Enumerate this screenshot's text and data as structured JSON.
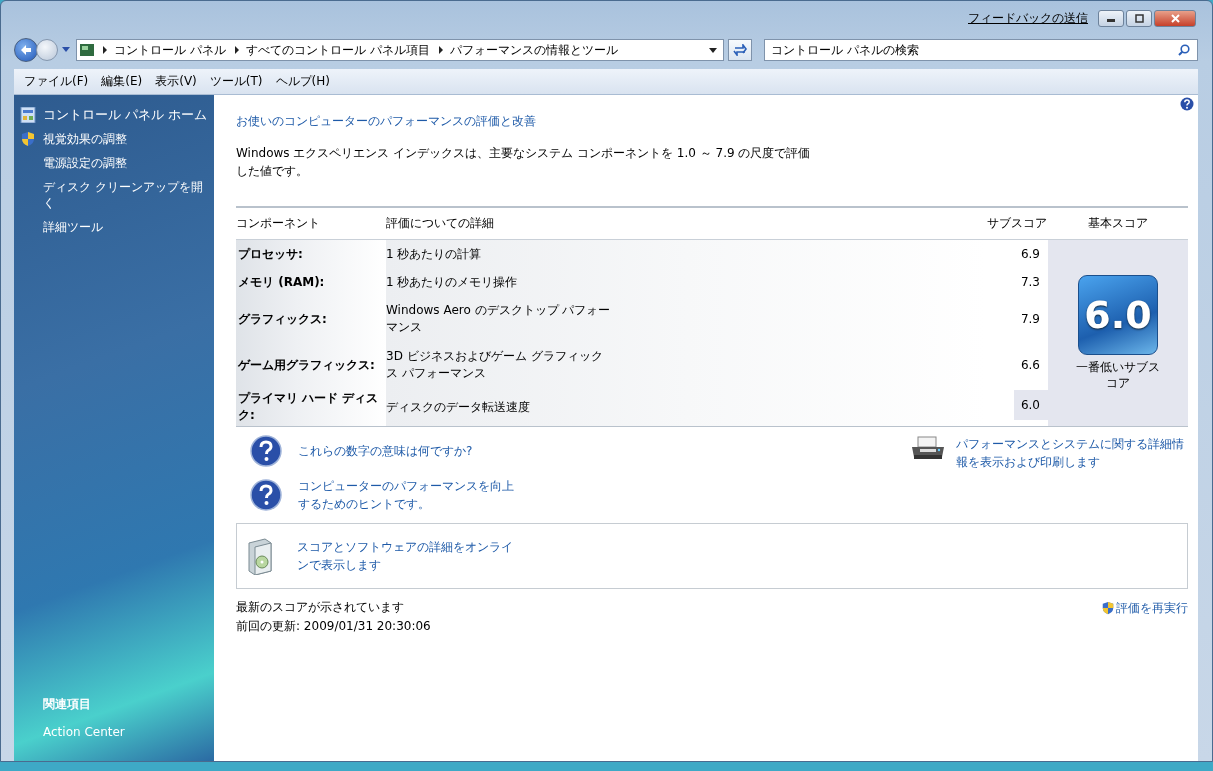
{
  "titlebar": {
    "feedback_link": "フィードバックの送信"
  },
  "address_bar": {
    "breadcrumbs": [
      "コントロール パネル",
      "すべてのコントロール パネル項目",
      "パフォーマンスの情報とツール"
    ]
  },
  "search": {
    "placeholder": "コントロール パネルの検索"
  },
  "menu": [
    "ファイル(F)",
    "編集(E)",
    "表示(V)",
    "ツール(T)",
    "ヘルプ(H)"
  ],
  "sidebar": {
    "items": [
      {
        "label": "コントロール パネル ホーム",
        "kind": "panel"
      },
      {
        "label": "視覚効果の調整",
        "kind": "shield"
      },
      {
        "label": "電源設定の調整",
        "kind": "plain"
      },
      {
        "label": "ディスク クリーンアップを開く",
        "kind": "plain"
      },
      {
        "label": "詳細ツール",
        "kind": "plain"
      }
    ],
    "related_heading": "関連項目",
    "related": [
      "Action Center"
    ]
  },
  "content": {
    "title": "お使いのコンピューターのパフォーマンスの評価と改善",
    "description": "Windows エクスペリエンス インデックスは、主要なシステム コンポーネントを 1.0 ～ 7.9 の尺度で評価した値です。",
    "table": {
      "columns": [
        "コンポーネント",
        "評価についての詳細",
        "サブスコア",
        "基本スコア"
      ],
      "rows": [
        {
          "component": "プロセッサ:",
          "detail": "1 秒あたりの計算",
          "subscore": "6.9",
          "lowest": false
        },
        {
          "component": "メモリ (RAM):",
          "detail": "1 秒あたりのメモリ操作",
          "subscore": "7.3",
          "lowest": false
        },
        {
          "component": "グラフィックス:",
          "detail": "Windows Aero のデスクトップ パフォーマンス",
          "subscore": "7.9",
          "lowest": false
        },
        {
          "component": "ゲーム用グラフィックス:",
          "detail": "3D ビジネスおよびゲーム グラフィックス パフォーマンス",
          "subscore": "6.6",
          "lowest": false
        },
        {
          "component": "プライマリ ハード ディスク:",
          "detail": "ディスクのデータ転送速度",
          "subscore": "6.0",
          "lowest": true
        }
      ],
      "base_score": "6.0",
      "base_caption": "一番低いサブスコア"
    },
    "help_links": [
      "これらの数字の意味は何ですか?",
      "コンピューターのパフォーマンスを向上するためのヒントです。"
    ],
    "print_link": "パフォーマンスとシステムに関する詳細情報を表示および印刷します",
    "online_link": "スコアとソフトウェアの詳細をオンラインで表示します",
    "status": "最新のスコアが示されています",
    "last_update": "前回の更新: 2009/01/31 20:30:06",
    "rerun_link": "評価を再実行"
  }
}
